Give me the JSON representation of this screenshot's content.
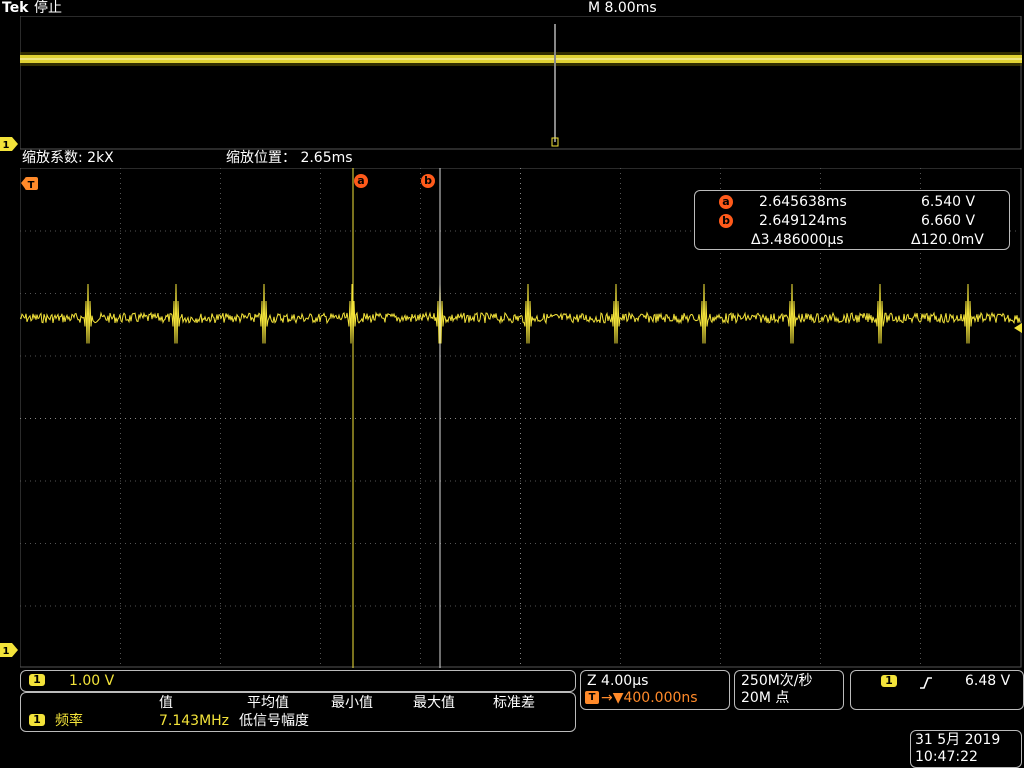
{
  "header": {
    "brand": "Tek",
    "run_state": "停止",
    "timebase": "M 8.00ms"
  },
  "zoom_bar": {
    "zoom_factor_label": "缩放系数: 2kX",
    "zoom_position_label": "缩放位置：  2.65ms"
  },
  "markers": {
    "trigger": "T",
    "cursor_a": "a",
    "cursor_b": "b",
    "channel_1": "1"
  },
  "cursor_readout": {
    "a_time": "2.645638ms",
    "a_volt": "6.540 V",
    "b_time": "2.649124ms",
    "b_volt": "6.660 V",
    "delta_time": "Δ3.486000µs",
    "delta_volt": "Δ120.0mV"
  },
  "channel_panel": {
    "channel": "1",
    "scale": "1.00 V"
  },
  "measurement": {
    "headers": [
      "值",
      "平均值",
      "最小值",
      "最大值",
      "标准差"
    ],
    "channel": "1",
    "name": "频率",
    "value": "7.143MHz",
    "note": "低信号幅度"
  },
  "zoom_panel": {
    "zoom_scale": "Z 4.00µs",
    "trigger_pos": "→▼400.000ns"
  },
  "acquisition": {
    "sample_rate": "250M次/秒",
    "record_length": "20M 点"
  },
  "trigger_panel": {
    "channel": "1",
    "slope_icon": "rising-edge",
    "level": "6.48 V"
  },
  "datetime": {
    "date": "31 5月  2019",
    "time": "10:47:22"
  },
  "colors": {
    "trace": "#f3e33a",
    "cursor_badge": "#ff5a1a",
    "trigger_orange": "#ff8a2a",
    "grid": "#6e6e6e"
  }
}
